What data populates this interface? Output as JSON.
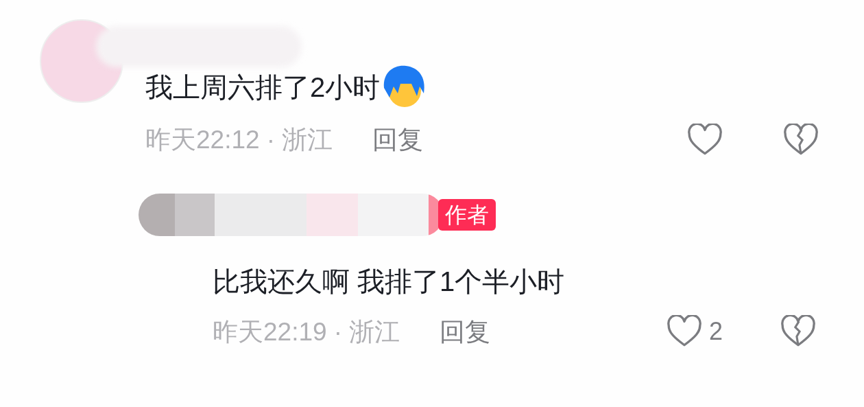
{
  "comments": [
    {
      "text": "我上周六排了2小时",
      "time_location": "昨天22:12 · 浙江",
      "reply_label": "回复",
      "emoji": true,
      "replies": [
        {
          "badge": "作者",
          "text": "比我还久啊 我排了1个半小时",
          "time_location": "昨天22:19 · 浙江",
          "reply_label": "回复",
          "like_count": "2",
          "emoji": false
        }
      ]
    }
  ]
}
